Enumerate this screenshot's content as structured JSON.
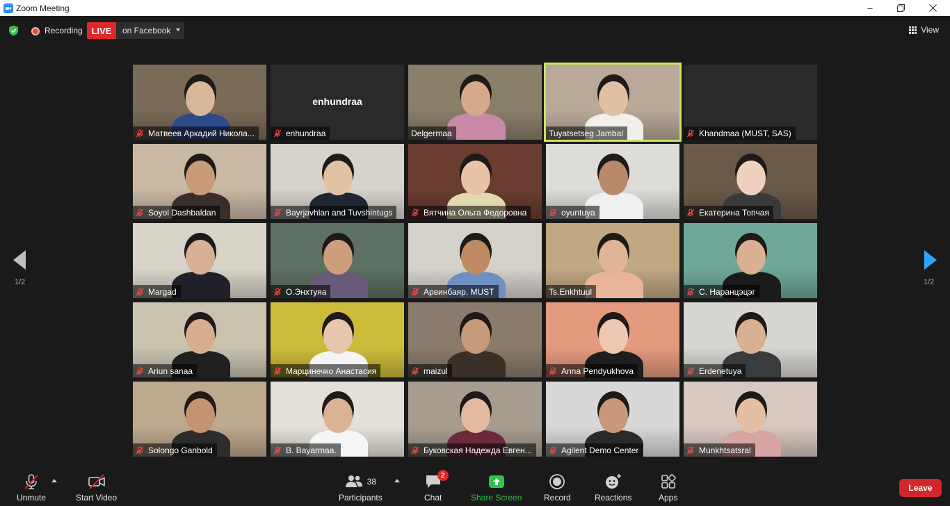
{
  "window": {
    "title": "Zoom Meeting",
    "minimize_icon": "minimize-icon",
    "restore_icon": "restore-icon",
    "close_icon": "close-icon"
  },
  "topbar": {
    "recording_label": "Recording",
    "live_label": "LIVE",
    "live_destination": "on Facebook",
    "view_label": "View",
    "colors": {
      "live": "#e02828",
      "recording_dot": "#e14c3c",
      "security": "#2fc24a"
    }
  },
  "gallery": {
    "active_speaker_color": "#c9e265",
    "tiles": [
      {
        "name": "Матвеев Аркадий Никола...",
        "muted": true,
        "video": true,
        "bg": "#7a6a58",
        "skin": "#d9b79a",
        "shirt": "#2d4a8a"
      },
      {
        "name": "enhundraa",
        "muted": true,
        "video": false,
        "center_label": "enhundraa"
      },
      {
        "name": "Delgermaa",
        "muted": false,
        "video": true,
        "bg": "#8a7f6a",
        "skin": "#d7a98a",
        "shirt": "#c88aa6"
      },
      {
        "name": "Tuyatsetseg Jambal",
        "muted": false,
        "video": true,
        "active": true,
        "bg": "#b9a999",
        "skin": "#e2c0a4",
        "shirt": "#f2efe9"
      },
      {
        "name": "Khandmaa (MUST, SAS)",
        "muted": true,
        "video": false
      },
      {
        "name": "Soyol Dashbaldan",
        "muted": true,
        "video": true,
        "bg": "#c9b8a4",
        "skin": "#c99a78",
        "shirt": "#3a2e2a"
      },
      {
        "name": "Bayrjavhlan and Tuvshintugs",
        "muted": true,
        "video": true,
        "bg": "#d6d3cc",
        "skin": "#e2c2a5",
        "shirt": "#1f2533"
      },
      {
        "name": "Вятчина Ольга Федоровна",
        "muted": true,
        "video": true,
        "bg": "#6a3d30",
        "skin": "#e9c3a8",
        "shirt": "#e3d9b0"
      },
      {
        "name": "oyuntuya",
        "muted": true,
        "video": true,
        "bg": "#dedcd8",
        "skin": "#b98a6a",
        "shirt": "#f0f0f0"
      },
      {
        "name": "Екатерина Топчая",
        "muted": true,
        "video": true,
        "bg": "#6b5a48",
        "skin": "#efd2be",
        "shirt": "#3a3a3a"
      },
      {
        "name": "Margad",
        "muted": true,
        "video": true,
        "bg": "#d9d4c9",
        "skin": "#d8b096",
        "shirt": "#20202a"
      },
      {
        "name": "О.Энхтуяа",
        "muted": true,
        "video": true,
        "bg": "#5c7063",
        "skin": "#cf9f7d",
        "shirt": "#6a5a7a"
      },
      {
        "name": "Арвинбаяр. MUST",
        "muted": true,
        "video": true,
        "bg": "#d5d2cc",
        "skin": "#bf8b62",
        "shirt": "#6d8fc4"
      },
      {
        "name": "Ts.Enkhtuul",
        "muted": false,
        "video": true,
        "bg": "#bfa883",
        "skin": "#e0b596",
        "shirt": "#e9b59a"
      },
      {
        "name": "С. Наранцэцэг",
        "muted": true,
        "video": true,
        "bg": "#6fa89a",
        "skin": "#d9b091",
        "shirt": "#1b1b1b"
      },
      {
        "name": "Ariun sanaa",
        "muted": true,
        "video": true,
        "bg": "#c9c3b0",
        "skin": "#d8ae90",
        "shirt": "#202020"
      },
      {
        "name": "Марцинечко Анастасия",
        "muted": true,
        "video": true,
        "bg": "#cdbc3a",
        "skin": "#e8c6ad",
        "shirt": "#f4f4f4"
      },
      {
        "name": "maizul",
        "muted": true,
        "video": true,
        "bg": "#8a7c6c",
        "skin": "#c79a7a",
        "shirt": "#3a3028"
      },
      {
        "name": "Anna Pendyukhova",
        "muted": true,
        "video": true,
        "bg": "#e49a7e",
        "skin": "#ecc8b2",
        "shirt": "#1e1e1e"
      },
      {
        "name": "Erdenetuya",
        "muted": true,
        "video": true,
        "bg": "#d8d6d2",
        "skin": "#d9b092",
        "shirt": "#3b3b3b"
      },
      {
        "name": "Solongo Ganbold",
        "muted": true,
        "video": true,
        "bg": "#bda98e",
        "skin": "#c39372",
        "shirt": "#2c2c2c"
      },
      {
        "name": "B. Bayarmaa.",
        "muted": true,
        "video": true,
        "bg": "#e4e0d9",
        "skin": "#dbb294",
        "shirt": "#f6f6f6"
      },
      {
        "name": "Буковская Надежда Евген...",
        "muted": true,
        "video": true,
        "bg": "#a79d8f",
        "skin": "#e3b9a0",
        "shirt": "#6a2a3a"
      },
      {
        "name": "Agilent Demo Center",
        "muted": true,
        "video": true,
        "bg": "#d8d8d8",
        "skin": "#c99878",
        "shirt": "#2a2a2a"
      },
      {
        "name": "Munkhtsatsral",
        "muted": true,
        "video": true,
        "bg": "#d7c9c1",
        "skin": "#e5bfa5",
        "shirt": "#d9a4a4"
      }
    ]
  },
  "pagination": {
    "left": "1/2",
    "right": "1/2",
    "right_arrow_color": "#2da5ff"
  },
  "toolbar": {
    "unmute_label": "Unmute",
    "start_video_label": "Start Video",
    "participants_label": "Participants",
    "participants_count": "38",
    "chat_label": "Chat",
    "chat_badge": "2",
    "share_label": "Share Screen",
    "record_label": "Record",
    "reactions_label": "Reactions",
    "apps_label": "Apps",
    "leave_label": "Leave",
    "colors": {
      "share": "#2fc24a",
      "leave": "#d1262b"
    }
  }
}
